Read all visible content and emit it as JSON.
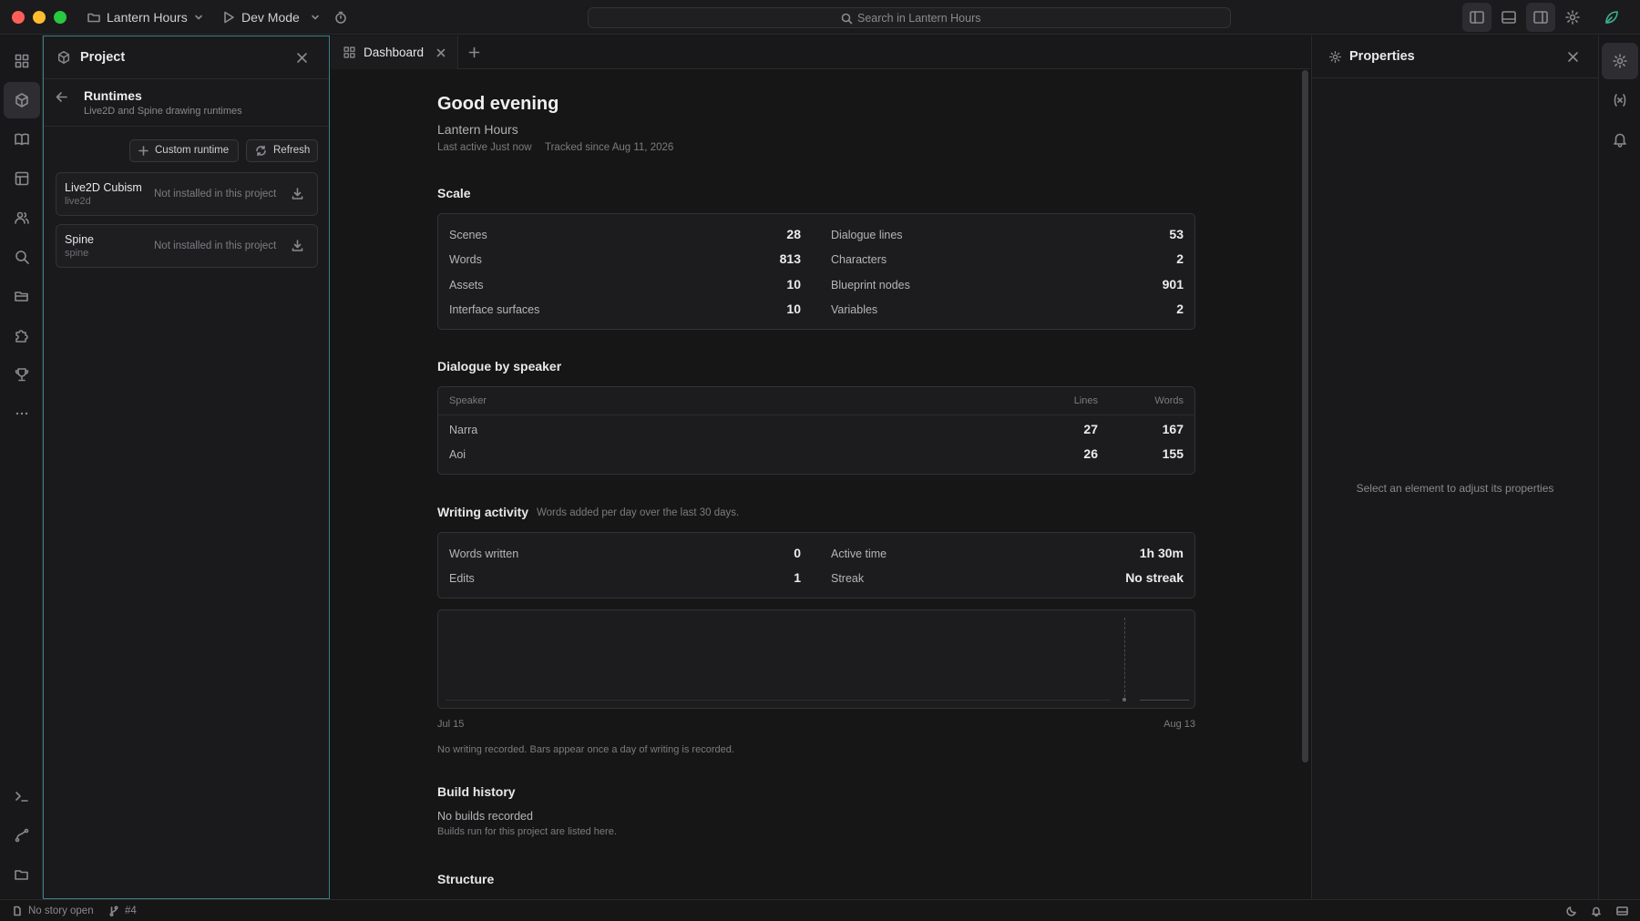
{
  "app": {
    "project_name": "Lantern Hours",
    "mode": "Dev Mode",
    "search_placeholder": "Search in Lantern Hours"
  },
  "project_panel": {
    "title": "Project",
    "section_title": "Runtimes",
    "section_subtitle": "Live2D and Spine drawing runtimes",
    "custom_runtime_label": "Custom runtime",
    "refresh_label": "Refresh",
    "runtimes": [
      {
        "name": "Live2D Cubism",
        "id": "live2d",
        "status": "Not installed in this project"
      },
      {
        "name": "Spine",
        "id": "spine",
        "status": "Not installed in this project"
      }
    ]
  },
  "tabs": [
    {
      "label": "Dashboard"
    }
  ],
  "dashboard": {
    "greeting": "Good evening",
    "project_name": "Lantern Hours",
    "last_active": "Last active Just now",
    "tracked_since": "Tracked since Aug 11, 2026",
    "scale": {
      "title": "Scale",
      "left": [
        {
          "label": "Scenes",
          "value": "28"
        },
        {
          "label": "Words",
          "value": "813"
        },
        {
          "label": "Assets",
          "value": "10"
        },
        {
          "label": "Interface surfaces",
          "value": "10"
        }
      ],
      "right": [
        {
          "label": "Dialogue lines",
          "value": "53"
        },
        {
          "label": "Characters",
          "value": "2"
        },
        {
          "label": "Blueprint nodes",
          "value": "901"
        },
        {
          "label": "Variables",
          "value": "2"
        }
      ]
    },
    "dialogue": {
      "title": "Dialogue by speaker",
      "columns": [
        "Speaker",
        "Lines",
        "Words"
      ],
      "rows": [
        {
          "speaker": "Narra",
          "lines": "27",
          "words": "167"
        },
        {
          "speaker": "Aoi",
          "lines": "26",
          "words": "155"
        }
      ]
    },
    "writing": {
      "title": "Writing activity",
      "subtitle": "Words added per day over the last 30 days.",
      "left": [
        {
          "label": "Words written",
          "value": "0"
        },
        {
          "label": "Edits",
          "value": "1"
        }
      ],
      "right": [
        {
          "label": "Active time",
          "value": "1h 30m"
        },
        {
          "label": "Streak",
          "value": "No streak"
        }
      ],
      "chart_start": "Jul 15",
      "chart_end": "Aug 13",
      "empty_note": "No writing recorded. Bars appear once a day of writing is recorded."
    },
    "build": {
      "title": "Build history",
      "empty_title": "No builds recorded",
      "empty_sub": "Builds run for this project are listed here."
    },
    "structure_title": "Structure"
  },
  "properties": {
    "title": "Properties",
    "empty": "Select an element to adjust its properties"
  },
  "statusbar": {
    "story": "No story open",
    "branch": "#4"
  },
  "colors": {
    "accent_teal": "#3a7f86",
    "background": "#161617",
    "card": "#1c1c1e"
  }
}
